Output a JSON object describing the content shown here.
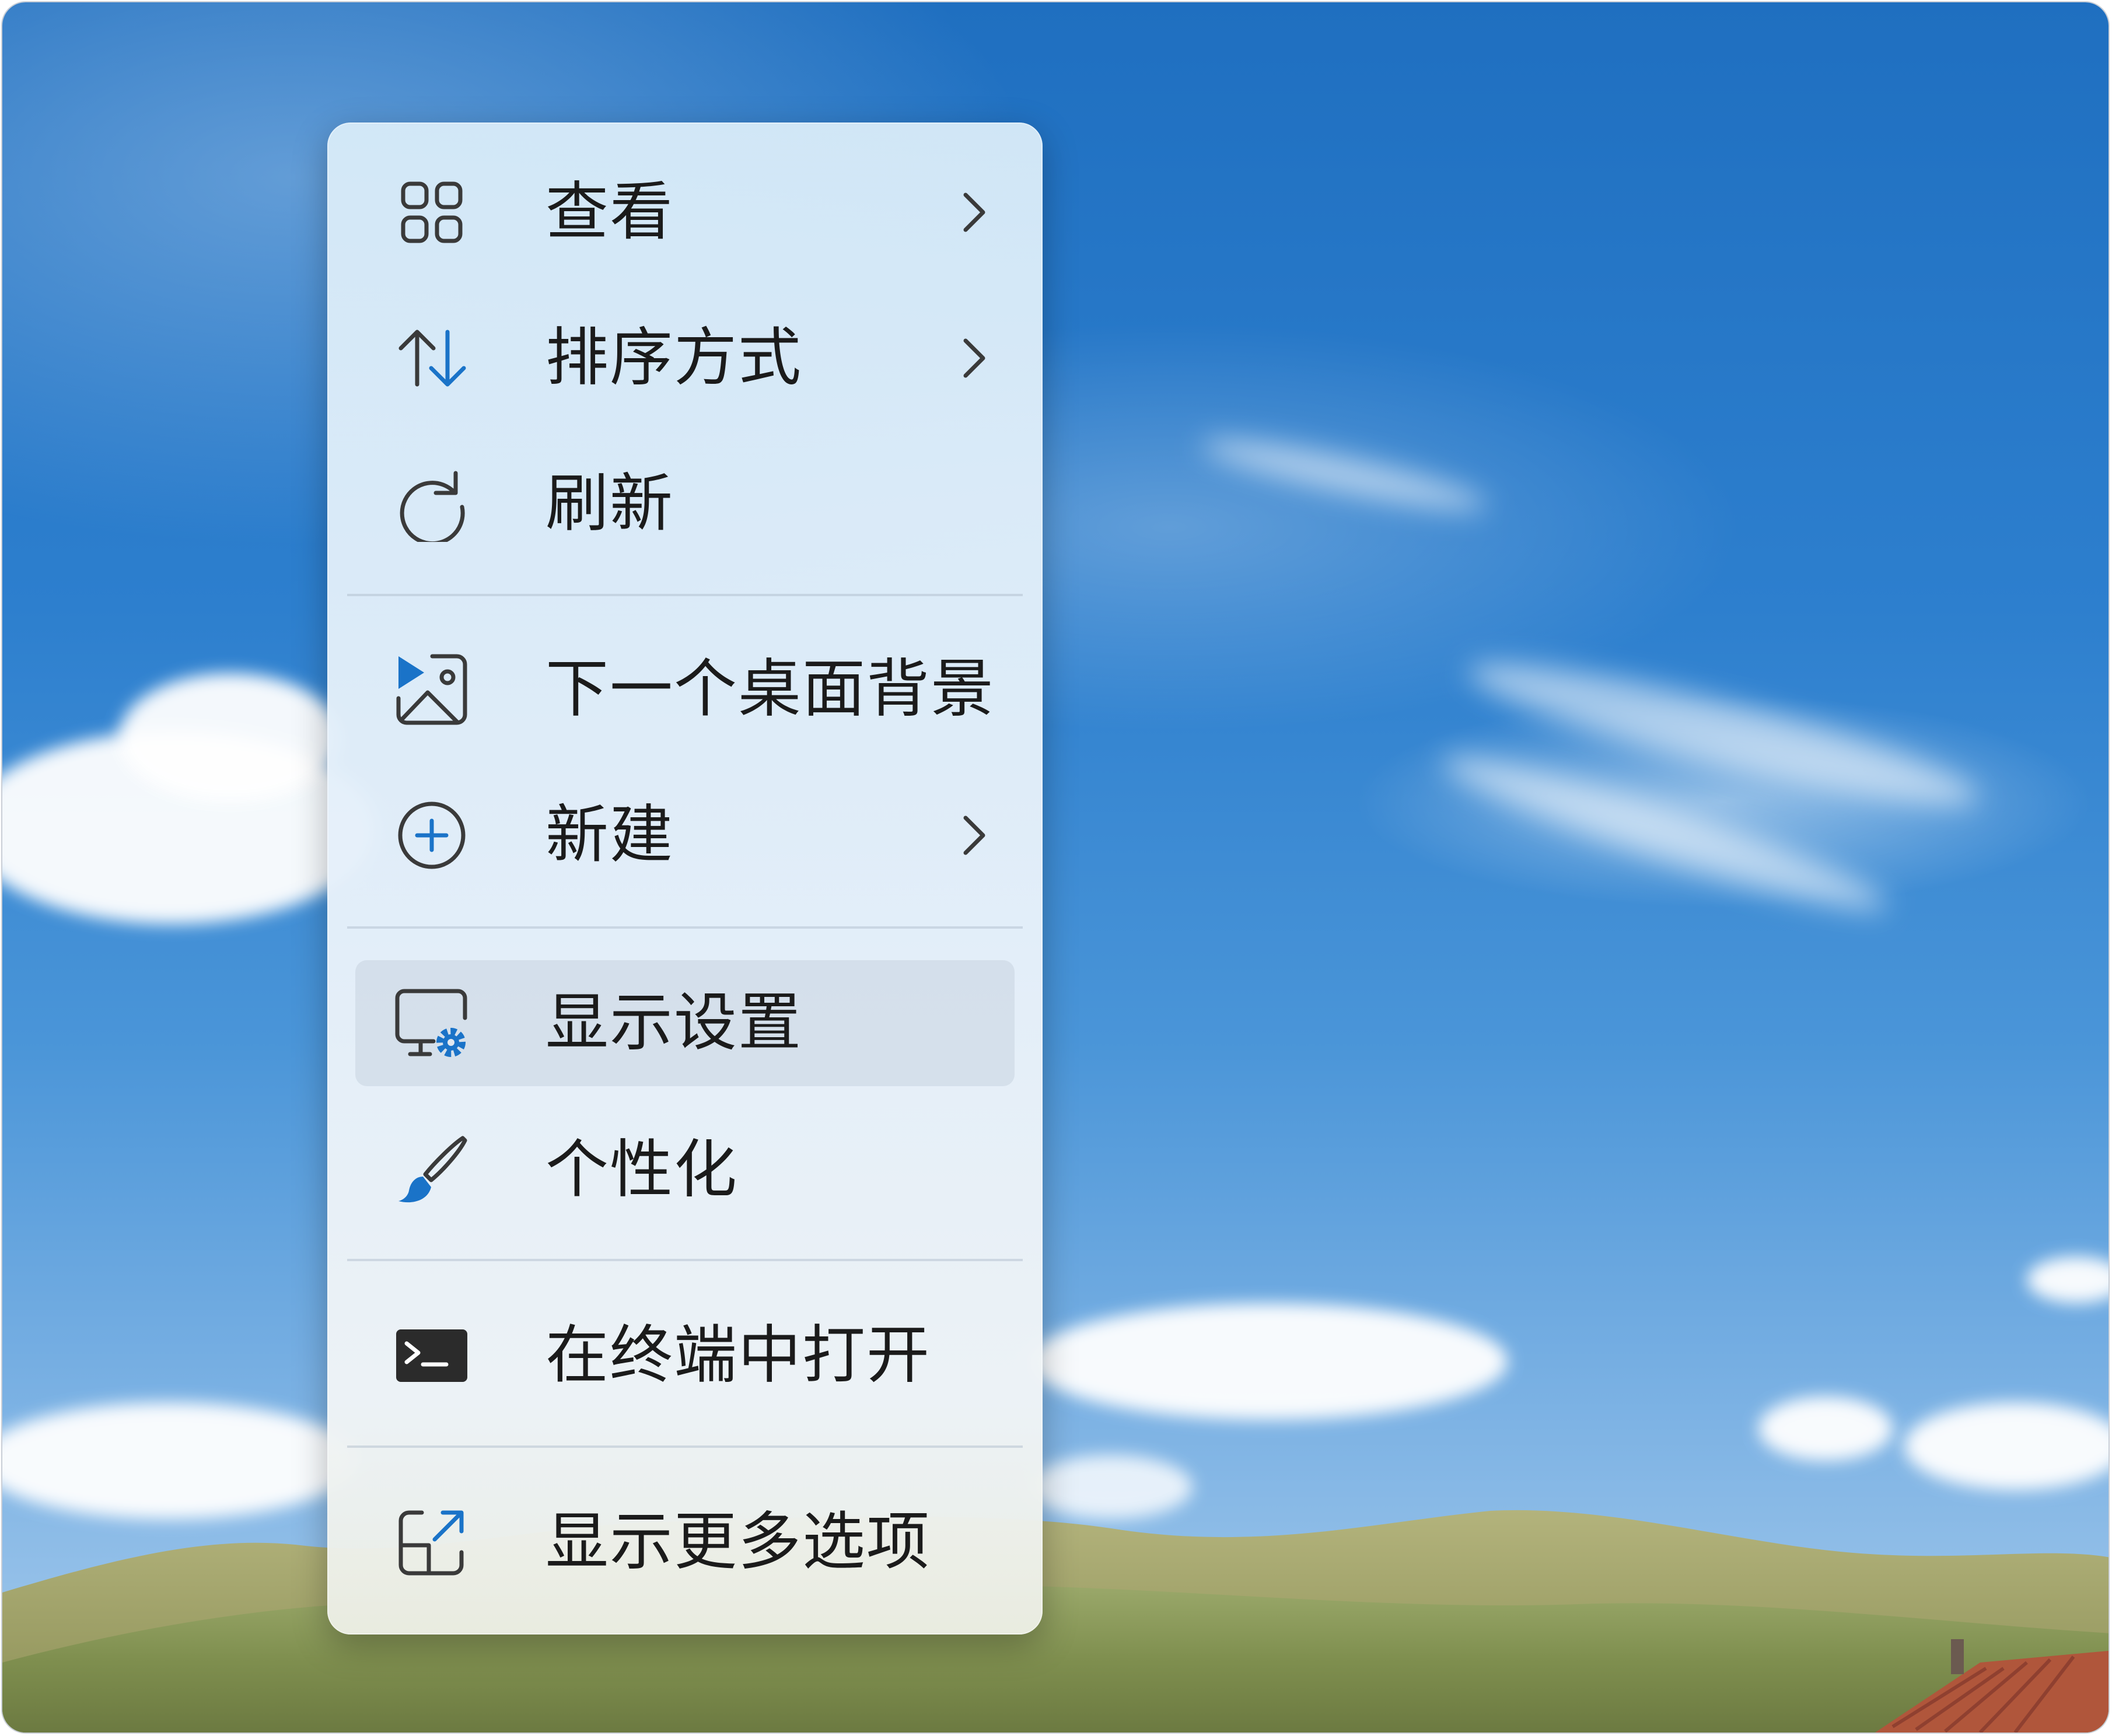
{
  "desktop": {
    "wallpaper": "sky-clouds-hills"
  },
  "context_menu": {
    "items": [
      {
        "label": "查看",
        "icon": "grid-view-icon",
        "has_submenu": true
      },
      {
        "label": "排序方式",
        "icon": "sort-arrows-icon",
        "has_submenu": true
      },
      {
        "label": "刷新",
        "icon": "refresh-icon",
        "has_submenu": false
      },
      {
        "label": "下一个桌面背景",
        "icon": "next-background-icon",
        "has_submenu": false
      },
      {
        "label": "新建",
        "icon": "plus-circle-icon",
        "has_submenu": true
      },
      {
        "label": "显示设置",
        "icon": "display-settings-icon",
        "has_submenu": false,
        "highlighted": true
      },
      {
        "label": "个性化",
        "icon": "brush-icon",
        "has_submenu": false
      },
      {
        "label": "在终端中打开",
        "icon": "terminal-icon",
        "has_submenu": false
      },
      {
        "label": "显示更多选项",
        "icon": "more-options-icon",
        "has_submenu": false
      }
    ]
  },
  "colors": {
    "accent": "#1a73c8",
    "text": "#1b1b1b",
    "icon": "#3a3a3a",
    "hover": "#cdd7e4"
  }
}
